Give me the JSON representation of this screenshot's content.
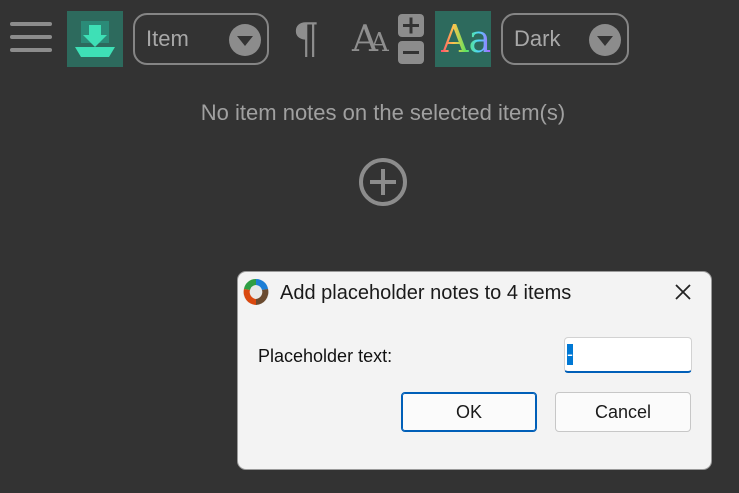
{
  "toolbar": {
    "scope_dropdown": {
      "selected": "Item"
    },
    "theme_dropdown": {
      "selected": "Dark"
    },
    "pilcrow_glyph": "¶",
    "font_size_glyph_large": "A",
    "font_size_glyph_small": "A",
    "font_style_glyph": "Aa",
    "accent_color": "#2d6a5d"
  },
  "main": {
    "empty_message": "No item notes on the selected item(s)",
    "add_icon": "plus-circle-icon"
  },
  "dialog": {
    "title": "Add placeholder notes to 4 items",
    "field_label": "Placeholder text:",
    "field_value": "-",
    "ok_label": "OK",
    "cancel_label": "Cancel",
    "close_icon": "close-icon"
  }
}
